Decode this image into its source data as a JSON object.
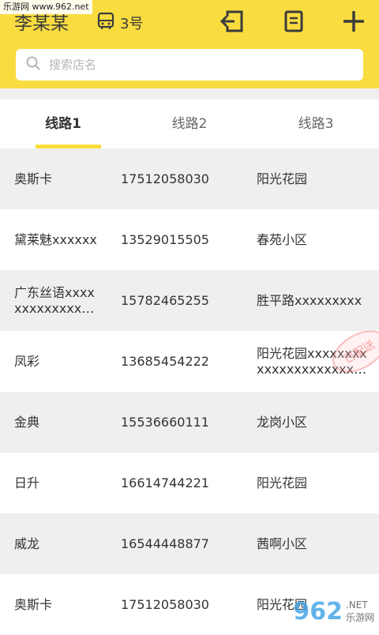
{
  "watermark_top": "乐游网 www.962.net",
  "header": {
    "title": "李某某",
    "bus_icon": "bus-icon",
    "bus_number": "3号",
    "actions": [
      "exit-icon",
      "document-icon",
      "add-icon"
    ]
  },
  "search": {
    "placeholder": "搜索店名",
    "icon": "search-icon"
  },
  "tabs": [
    {
      "label": "线路1",
      "active": true
    },
    {
      "label": "线路2",
      "active": false
    },
    {
      "label": "线路3",
      "active": false
    }
  ],
  "rows": [
    {
      "name": "奥斯卡",
      "phone": "17512058030",
      "address": "阳光花园"
    },
    {
      "name": "黛莱魅xxxxxx",
      "phone": "13529015505",
      "address": "春苑小区"
    },
    {
      "name": "广东丝语xxxxxxxxxxxxxxx…",
      "phone": "15782465255",
      "address": "胜平路xxxxxxxxx"
    },
    {
      "name": "凤彩",
      "phone": "13685454222",
      "address": "阳光花园xxxxxxxxxxxxxxxxxxxxx…",
      "stamp": "已配送"
    },
    {
      "name": "金典",
      "phone": "15536660111",
      "address": "龙岗小区"
    },
    {
      "name": "日升",
      "phone": "16614744221",
      "address": "阳光花园"
    },
    {
      "name": "威龙",
      "phone": "16544448877",
      "address": "茜啊小区"
    },
    {
      "name": "奥斯卡",
      "phone": "17512058030",
      "address": "阳光花园"
    }
  ],
  "watermark_bottom": {
    "logo": "962",
    "domain": ".NET",
    "site": "乐游网"
  },
  "colors": {
    "accent": "#f9dc3f",
    "row_gray": "#efefef"
  }
}
